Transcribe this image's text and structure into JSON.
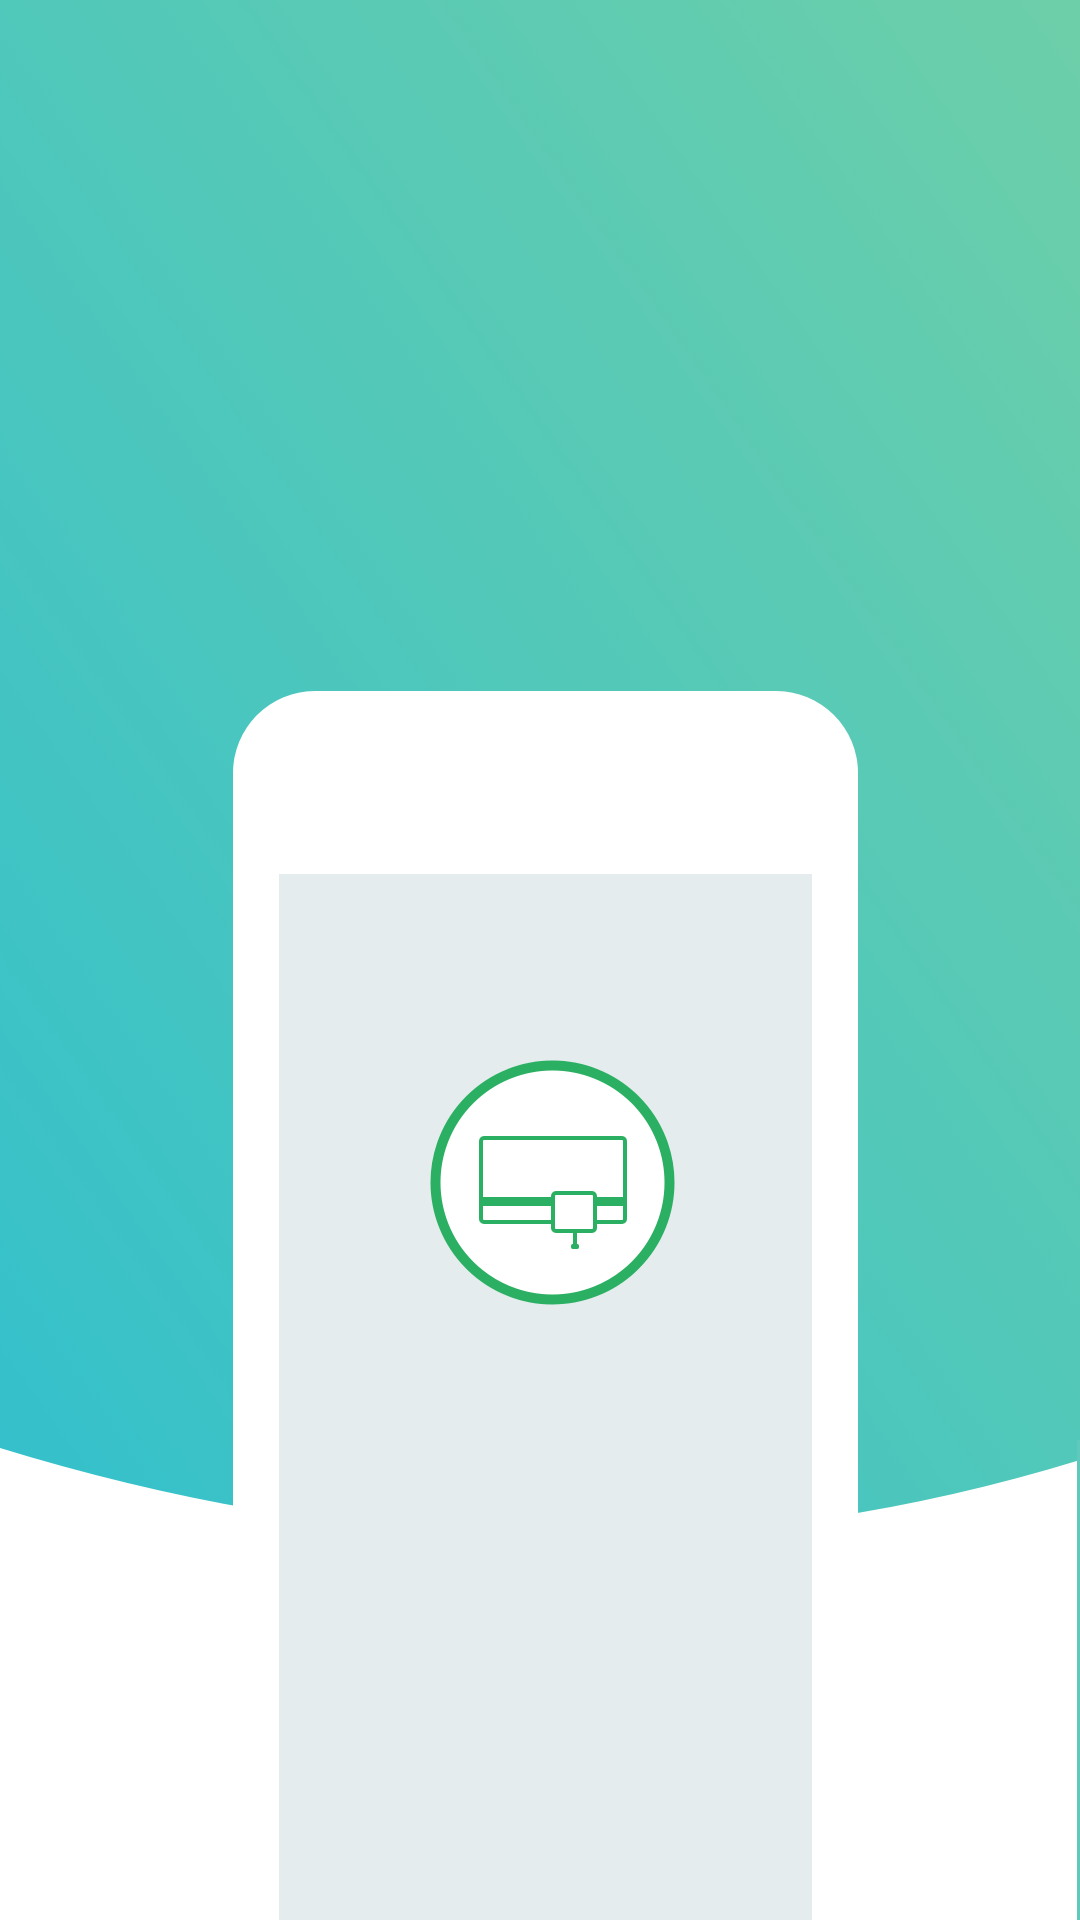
{
  "theme": {
    "gradient_top": "#6dcfa9",
    "gradient_bottom": "#33c0cc",
    "phone_color": "#ffffff",
    "screen_color": "#e4eced",
    "logo_color": "#2bb063"
  },
  "splash": {
    "logo_icon": "tv-set-top-box-icon"
  }
}
